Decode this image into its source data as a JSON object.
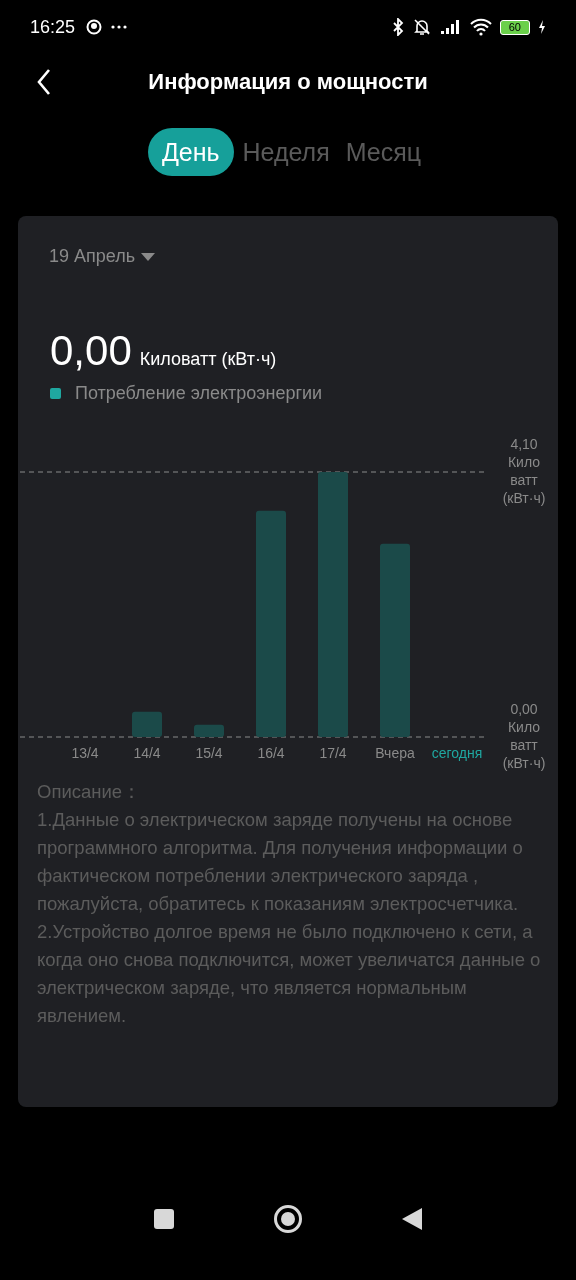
{
  "status_bar": {
    "time": "16:25",
    "battery": "60"
  },
  "header": {
    "title": "Информация о мощности"
  },
  "tabs": [
    {
      "label": "День",
      "selected": true
    },
    {
      "label": "Неделя",
      "selected": false
    },
    {
      "label": "Месяц",
      "selected": false
    }
  ],
  "card": {
    "date": "19 Апрель",
    "total": "0,00",
    "unit": "Киловатт (кВт·ч)",
    "legend": {
      "color": "#1fa7a0"
    },
    "current_day": {
      "color": "#1fa7a0"
    },
    "chart_data": {
      "type": "bar",
      "categories": [
        "13/4",
        "14/4",
        "15/4",
        "16/4",
        "17/4",
        "Вчера",
        "сегодня"
      ],
      "series": [
        {
          "name": "Потребление электроэнергии",
          "color": "#1b4a49",
          "values": [
            0,
            0.39,
            0.19,
            3.5,
            4.1,
            2.99,
            0
          ]
        }
      ],
      "ylim": [
        0,
        4.1
      ],
      "yticks": [
        {
          "value": 0,
          "label": "0,00 Кило ватт (кВт·ч)"
        },
        {
          "value": 4.1,
          "label": "4,10 Кило ватт (кВт·ч)"
        }
      ]
    },
    "description": {
      "title": "Описание：",
      "items": [
        "1.Данные о электрическом заряде  получены на основе программного алгоритма. Для получения информации о фактическом потреблении электрического заряда , пожалуйста, обратитесь к показаниям электросчетчика.",
        "2.Устройство долгое время не было подключено к сети, а когда оно снова подключится, может увеличатся данные о электрическом заряде, что является нормальным явлением."
      ]
    }
  }
}
